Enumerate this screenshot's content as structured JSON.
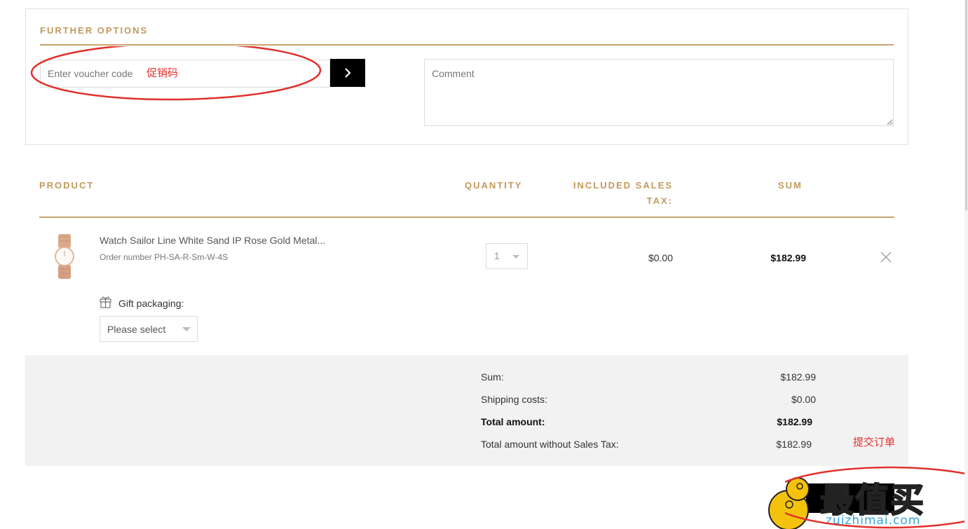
{
  "further_options": {
    "title": "FURTHER OPTIONS",
    "voucher_placeholder": "Enter voucher code",
    "voucher_annotation": "促销码",
    "comment_placeholder": "Comment"
  },
  "table_header": {
    "product": "PRODUCT",
    "quantity": "QUANTITY",
    "tax_line1": "INCLUDED SALES",
    "tax_line2": "TAX:",
    "sum": "SUM"
  },
  "line_item": {
    "name": "Watch Sailor Line White Sand IP Rose Gold Metal...",
    "order_number": "Order number PH-SA-R-Sm-W-4S",
    "quantity": "1",
    "tax": "$0.00",
    "sum": "$182.99",
    "gift_label": "Gift packaging:",
    "gift_select": "Please select"
  },
  "summary": {
    "rows": [
      {
        "label": "Sum:",
        "value": "$182.99"
      },
      {
        "label": "Shipping costs:",
        "value": "$0.00"
      },
      {
        "label": "Total amount:",
        "value": "$182.99"
      },
      {
        "label": "Total amount without Sales Tax:",
        "value": "$182.99"
      }
    ],
    "submit_annotation": "提交订单"
  },
  "watermark": {
    "title": "最值买",
    "url": "zuizhimai.com"
  },
  "colors": {
    "accent_gold": "#c39a5c",
    "annotation_red": "#e0302a",
    "summary_bg": "#f2f2f2"
  }
}
